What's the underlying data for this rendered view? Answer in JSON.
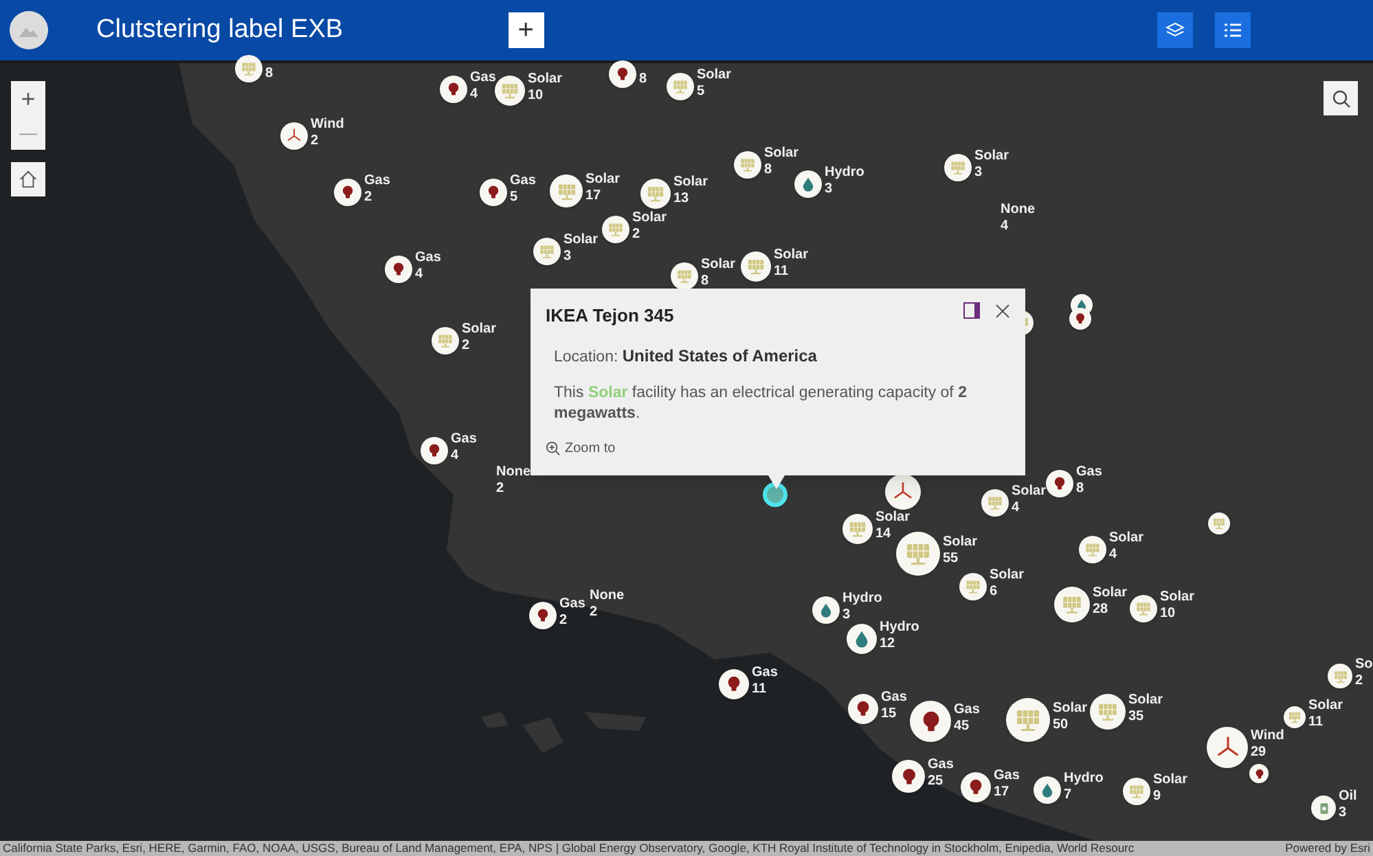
{
  "header": {
    "title": "Clutstering label EXB",
    "add_button": "+"
  },
  "clusters": [
    {
      "kind": "solar",
      "count": "8"
    },
    {
      "kind": "gas",
      "label": "Gas",
      "count": "4"
    },
    {
      "kind": "solar",
      "label": "Solar",
      "count": "10"
    },
    {
      "kind": "gas",
      "count": "8"
    },
    {
      "kind": "solar",
      "label": "Solar",
      "count": "5"
    },
    {
      "kind": "wind",
      "label": "Wind",
      "count": "2"
    },
    {
      "kind": "gas",
      "label": "Gas",
      "count": "2"
    },
    {
      "kind": "gas",
      "label": "Gas",
      "count": "5"
    },
    {
      "kind": "solar",
      "label": "Solar",
      "count": "17"
    },
    {
      "kind": "solar",
      "label": "Solar",
      "count": "13"
    },
    {
      "kind": "solar",
      "label": "Solar",
      "count": "2"
    },
    {
      "kind": "solar",
      "label": "Solar",
      "count": "3"
    },
    {
      "kind": "solar",
      "label": "Solar",
      "count": "8"
    },
    {
      "kind": "hydro",
      "label": "Hydro",
      "count": "3"
    },
    {
      "kind": "solar",
      "label": "Solar",
      "count": "3"
    },
    {
      "kind": "none",
      "label": "None",
      "count": "4"
    },
    {
      "kind": "gas",
      "label": "Gas",
      "count": "4"
    },
    {
      "kind": "solar",
      "label": "Solar",
      "count": "8"
    },
    {
      "kind": "solar",
      "label": "Solar",
      "count": "11"
    },
    {
      "kind": "solar",
      "label": "Solar",
      "count": "2"
    },
    {
      "kind": "gas",
      "label": "Gas",
      "count": "4"
    },
    {
      "kind": "none",
      "label": "None",
      "count": "2"
    },
    {
      "kind": "gas",
      "label": "Gas",
      "count": "2"
    },
    {
      "kind": "none",
      "label": "None",
      "count": "2"
    },
    {
      "kind": "wind"
    },
    {
      "kind": "gas",
      "label": "Gas",
      "count": "8"
    },
    {
      "kind": "solar",
      "label": "Solar",
      "count": "4"
    },
    {
      "kind": "solar"
    },
    {
      "kind": "solar",
      "label": "Solar",
      "count": "14"
    },
    {
      "kind": "solar",
      "label": "Solar",
      "count": "55"
    },
    {
      "kind": "solar",
      "label": "Solar",
      "count": "4"
    },
    {
      "kind": "solar",
      "label": "Solar",
      "count": "6"
    },
    {
      "kind": "hydro",
      "label": "Hydro",
      "count": "3"
    },
    {
      "kind": "solar",
      "label": "Solar",
      "count": "28"
    },
    {
      "kind": "solar",
      "label": "Solar",
      "count": "10"
    },
    {
      "kind": "hydro",
      "label": "Hydro",
      "count": "12"
    },
    {
      "kind": "gas",
      "label": "Gas",
      "count": "11"
    },
    {
      "kind": "gas",
      "label": "Gas",
      "count": "15"
    },
    {
      "kind": "gas",
      "label": "Gas",
      "count": "45"
    },
    {
      "kind": "solar",
      "label": "Solar",
      "count": "50"
    },
    {
      "kind": "solar",
      "label": "Solar",
      "count": "35"
    },
    {
      "kind": "solar",
      "label": "Solar",
      "count": "11"
    },
    {
      "kind": "wind",
      "label": "Wind",
      "count": "29"
    },
    {
      "kind": "gas"
    },
    {
      "kind": "gas",
      "label": "Gas",
      "count": "25"
    },
    {
      "kind": "gas",
      "label": "Gas",
      "count": "17"
    },
    {
      "kind": "hydro",
      "label": "Hydro",
      "count": "7"
    },
    {
      "kind": "solar",
      "label": "Solar",
      "count": "9"
    },
    {
      "kind": "solar",
      "label": "So",
      "count": "2"
    },
    {
      "kind": "oil",
      "label": "Oil",
      "count": "3"
    },
    {
      "kind": "solar"
    },
    {
      "kind": "hydro"
    },
    {
      "kind": "gas"
    }
  ],
  "popup": {
    "title": "IKEA Tejon 345",
    "location_label": "Location:",
    "location_value": "United States of America",
    "description_start": "This",
    "facility_type": "Solar",
    "description_end": "facility has an electrical generating capacity of **2 megawatts**.",
    "zoom_action": "Zoom to"
  },
  "zoom_controls": {
    "zoom_in": "+",
    "zoom_out": "—"
  },
  "attribution": "California State Parks, Esri, HERE, Garmin, FAO, NOAA, USGS, Bureau of Land Management, EPA, NPS | Global Energy Observatory, Google, KTH Royal Institute of Technology in Stockholm, Enipedia, World Resourc",
  "powered_by": "Powered by Esri"
}
